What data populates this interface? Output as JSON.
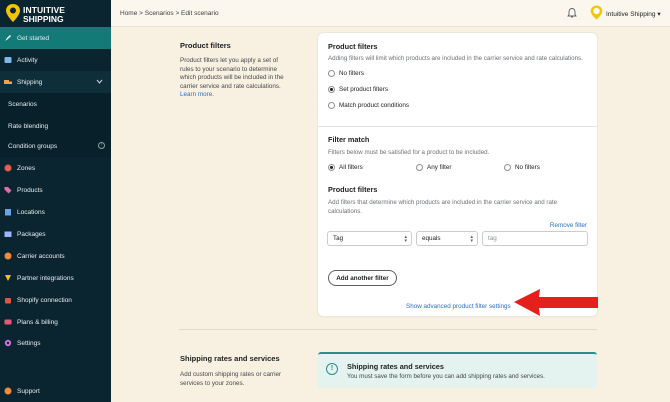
{
  "brand": {
    "line1": "INTUITIVE",
    "line2": "SHIPPING"
  },
  "sidebar": {
    "items": [
      {
        "label": "Get started",
        "icon": "rocket-icon"
      },
      {
        "label": "Activity",
        "icon": "activity-icon"
      },
      {
        "label": "Shipping",
        "icon": "truck-icon"
      },
      {
        "label": "Scenarios"
      },
      {
        "label": "Rate blending"
      },
      {
        "label": "Condition groups"
      },
      {
        "label": "Zones",
        "icon": "globe-icon"
      },
      {
        "label": "Products",
        "icon": "tag-icon"
      },
      {
        "label": "Locations",
        "icon": "building-icon"
      },
      {
        "label": "Packages",
        "icon": "box-icon"
      },
      {
        "label": "Carrier accounts",
        "icon": "carrier-icon"
      },
      {
        "label": "Partner integrations",
        "icon": "integration-icon"
      },
      {
        "label": "Shopify connection",
        "icon": "shopify-icon"
      },
      {
        "label": "Plans & billing",
        "icon": "billing-icon"
      },
      {
        "label": "Settings",
        "icon": "gear-icon"
      }
    ],
    "support": "Support",
    "info_glyph": "!"
  },
  "topbar": {
    "breadcrumb": "Home > Scenarios > Edit scenario",
    "account": "Intuitive Shipping",
    "account_caret": "▾"
  },
  "product_filters_section": {
    "title": "Product filters",
    "description": "Product filters let you apply a set of rules to your scenario to determine which products will be included in the carrier service and rate calculations.",
    "learn_more": "Learn more."
  },
  "card": {
    "heading": "Product filters",
    "subtext": "Adding filters will limit which products are included in the carrier service and rate calculations.",
    "options": [
      "No filters",
      "Set product filters",
      "Match product conditions"
    ],
    "selected_option": "Set product filters",
    "filter_match": {
      "heading": "Filter match",
      "subtext": "Filters below must be satisfied for a product to be included.",
      "options": [
        "All filters",
        "Any filter",
        "No filters"
      ],
      "selected": "All filters"
    },
    "filters": {
      "heading": "Product filters",
      "subtext": "Add filters that determine which products are included in the carrier service and rate calculations.",
      "remove_label": "Remove filter",
      "field_value": "Tag",
      "operator_value": "equals",
      "value_placeholder": "tag",
      "add_label": "Add another filter",
      "advanced_link": "Show advanced product filter settings"
    }
  },
  "shipping_rates_section": {
    "title": "Shipping rates and services",
    "description": "Add custom shipping rates or carrier services to your zones.",
    "banner_title": "Shipping rates and services",
    "banner_text": "You must save the form before you can add shipping rates and services."
  },
  "colors": {
    "sidebar": "#0b2530",
    "accent": "#147a78",
    "arrow": "#e3201b",
    "link": "#2c6ecb"
  }
}
